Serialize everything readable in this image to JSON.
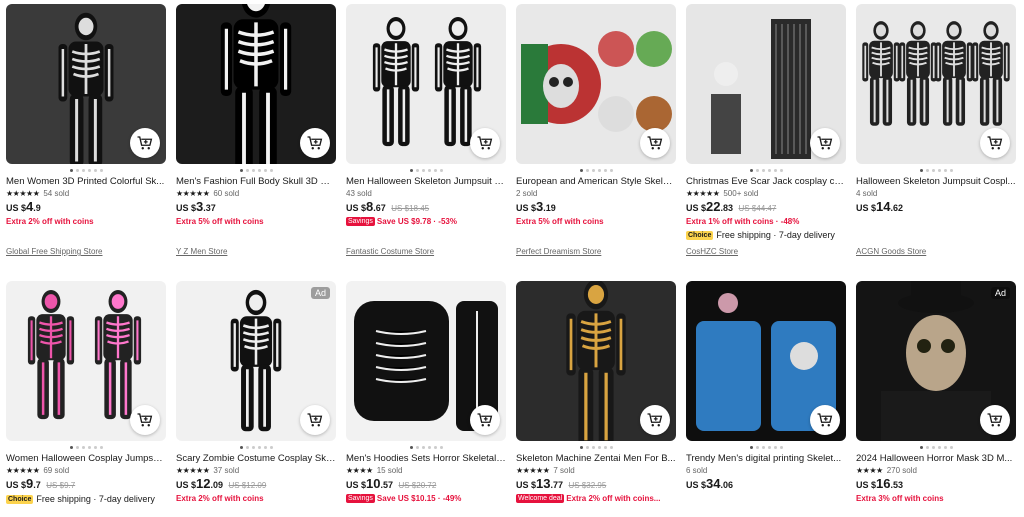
{
  "cart_icon": "shopping-cart-add-icon",
  "colors": {
    "accent": "#e6123d",
    "choice": "#fcd34d"
  },
  "products": [
    {
      "title": "Men Women 3D Printed Colorful Sk...",
      "rating": "★★★★★",
      "sold": "54 sold",
      "cur": "US $",
      "int": "4",
      "dec": ".9",
      "orig": "",
      "promo": "Extra 2% off with coins",
      "badge": "",
      "save": "",
      "ship": "",
      "choice": "",
      "store": "Global Free Shipping Store",
      "ad": ""
    },
    {
      "title": "Men's Fashion Full Body Skull 3D Pri...",
      "rating": "★★★★★",
      "sold": "60 sold",
      "cur": "US $",
      "int": "3",
      "dec": ".37",
      "orig": "",
      "promo": "Extra 5% off with coins",
      "badge": "",
      "save": "",
      "ship": "",
      "choice": "",
      "store": "Y Z Men Store",
      "ad": ""
    },
    {
      "title": "Men Halloween Skeleton Jumpsuit Z...",
      "rating": "",
      "sold": "43 sold",
      "cur": "US $",
      "int": "8",
      "dec": ".67",
      "orig": "US $18.45",
      "promo": "",
      "badge": "Savings",
      "save": "Save US $9.78 · -53%",
      "ship": "",
      "choice": "",
      "store": "Fantastic Costume Store",
      "ad": ""
    },
    {
      "title": "European and American Style Skelet...",
      "rating": "",
      "sold": "2 sold",
      "cur": "US $",
      "int": "3",
      "dec": ".19",
      "orig": "",
      "promo": "Extra 5% off with coins",
      "badge": "",
      "save": "",
      "ship": "",
      "choice": "",
      "store": "Perfect Dreamism Store",
      "ad": ""
    },
    {
      "title": "Christmas Eve Scar Jack cosplay cost...",
      "rating": "★★★★★",
      "sold": "500+ sold",
      "cur": "US $",
      "int": "22",
      "dec": ".83",
      "orig": "US $44.47",
      "promo": "Extra 1% off with coins · -48%",
      "badge": "",
      "save": "",
      "ship": "Free shipping · 7-day delivery",
      "choice": "Choice",
      "store": "CosHZC Store",
      "ad": ""
    },
    {
      "title": "Halloween Skeleton Jumpsuit Cospl...",
      "rating": "",
      "sold": "4 sold",
      "cur": "US $",
      "int": "14",
      "dec": ".62",
      "orig": "",
      "promo": "",
      "badge": "",
      "save": "",
      "ship": "",
      "choice": "",
      "store": "ACGN Goods Store",
      "ad": ""
    },
    {
      "title": "Women Halloween Cosplay Jumpsui...",
      "rating": "★★★★★",
      "sold": "69 sold",
      "cur": "US $",
      "int": "9",
      "dec": ".7",
      "orig": "US $9.7",
      "promo": "",
      "badge": "",
      "save": "",
      "ship": "Free shipping · 7-day delivery",
      "choice": "Choice",
      "store": "",
      "ad": ""
    },
    {
      "title": "Scary Zombie Costume Cosplay Skel...",
      "rating": "★★★★★",
      "sold": "37 sold",
      "cur": "US $",
      "int": "12",
      "dec": ".09",
      "orig": "US $12.09",
      "promo": "Extra 2% off with coins",
      "badge": "",
      "save": "",
      "ship": "",
      "choice": "",
      "store": "",
      "ad": "Ad"
    },
    {
      "title": "Men's Hoodies Sets Horror Skeletal ...",
      "rating": "★★★★",
      "sold": "15 sold",
      "cur": "US $",
      "int": "10",
      "dec": ".57",
      "orig": "US $20.72",
      "promo": "",
      "badge": "Savings",
      "save": "Save US $10.15 · -49%",
      "ship": "",
      "choice": "",
      "store": "",
      "ad": ""
    },
    {
      "title": "Skeleton Machine Zentai Men For B...",
      "rating": "★★★★★",
      "sold": "7 sold",
      "cur": "US $",
      "int": "13",
      "dec": ".77",
      "orig": "US $32.95",
      "promo": "",
      "badge": "Welcome deal",
      "save": "Extra 2% off with coins...",
      "ship": "",
      "choice": "",
      "store": "",
      "ad": ""
    },
    {
      "title": "Trendy Men's digital printing Skelet...",
      "rating": "",
      "sold": "6 sold",
      "cur": "US $",
      "int": "34",
      "dec": ".06",
      "orig": "",
      "promo": "",
      "badge": "",
      "save": "",
      "ship": "",
      "choice": "",
      "store": "",
      "ad": ""
    },
    {
      "title": "2024 Halloween Horror Mask 3D M...",
      "rating": "★★★★",
      "sold": "270 sold",
      "cur": "US $",
      "int": "16",
      "dec": ".53",
      "orig": "",
      "promo": "Extra 3% off with coins",
      "badge": "",
      "save": "",
      "ship": "",
      "choice": "",
      "store": "",
      "ad": "Ad"
    }
  ]
}
